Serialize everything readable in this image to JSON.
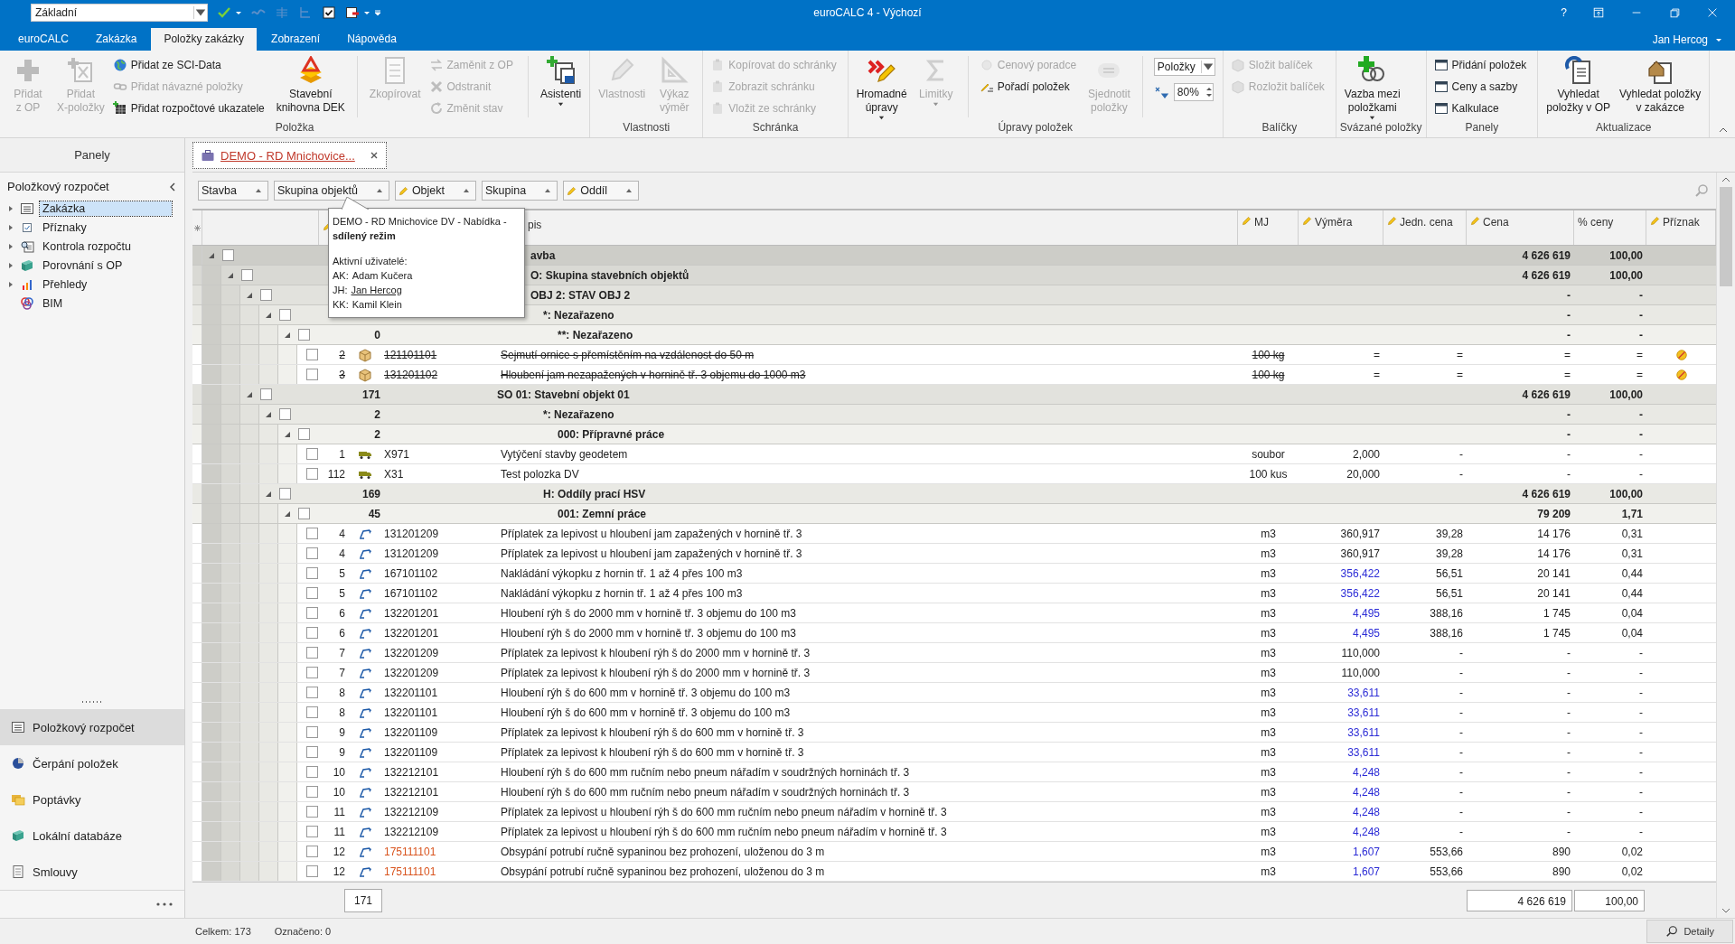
{
  "titlebar": {
    "layout_combo": "Základní",
    "title": "euroCALC 4 - Výchozí",
    "help": "?"
  },
  "tabs": [
    {
      "label": "euroCALC",
      "selected": false
    },
    {
      "label": "Zakázka",
      "selected": false
    },
    {
      "label": "Položky zakázky",
      "selected": true
    },
    {
      "label": "Zobrazení",
      "selected": false
    },
    {
      "label": "Nápověda",
      "selected": false
    }
  ],
  "user": "Jan Hercog",
  "ribbon": {
    "groups": [
      {
        "label": "Položka",
        "parts": [
          {
            "kind": "large",
            "lines": [
              "Přidat",
              "z OP"
            ],
            "disabled": true,
            "dropdown": false
          },
          {
            "kind": "large",
            "lines": [
              "Přidat",
              "X-položky"
            ],
            "disabled": true,
            "dropdown": false
          },
          {
            "kind": "stack",
            "items": [
              {
                "label": "Přidat ze SCI-Data",
                "disabled": false
              },
              {
                "label": "Přidat návazné položky",
                "disabled": true
              },
              {
                "label": "Přidat rozpočtové ukazatele",
                "disabled": false
              }
            ]
          },
          {
            "kind": "large",
            "lines": [
              "Stavební",
              "knihovna DEK"
            ],
            "disabled": false,
            "dropdown": false
          },
          {
            "kind": "separator"
          },
          {
            "kind": "large",
            "lines": [
              "Zkopírovat"
            ],
            "disabled": true,
            "dropdown": false
          },
          {
            "kind": "stack",
            "items": [
              {
                "label": "Zaměnit z OP",
                "disabled": true
              },
              {
                "label": "Odstranit",
                "disabled": true
              },
              {
                "label": "Změnit stav",
                "disabled": true
              }
            ]
          },
          {
            "kind": "separator"
          },
          {
            "kind": "large",
            "lines": [
              "Asistenti"
            ],
            "disabled": false,
            "dropdown": true
          }
        ]
      },
      {
        "label": "Vlastnosti",
        "parts": [
          {
            "kind": "large",
            "lines": [
              "Vlastnosti"
            ],
            "disabled": true,
            "dropdown": false
          },
          {
            "kind": "large",
            "lines": [
              "Výkaz",
              "výměr"
            ],
            "disabled": true,
            "dropdown": false
          }
        ]
      },
      {
        "label": "Schránka",
        "parts": [
          {
            "kind": "stack",
            "items": [
              {
                "label": "Kopírovat do schránky",
                "disabled": true
              },
              {
                "label": "Zobrazit schránku",
                "disabled": true
              },
              {
                "label": "Vložit ze schránky",
                "disabled": true
              }
            ]
          }
        ]
      },
      {
        "label": "Úpravy položek",
        "parts": [
          {
            "kind": "large",
            "lines": [
              "Hromadné",
              "úpravy"
            ],
            "disabled": false,
            "dropdown": true
          },
          {
            "kind": "large",
            "lines": [
              "Limitky"
            ],
            "disabled": true,
            "dropdown": true
          },
          {
            "kind": "separator"
          },
          {
            "kind": "stack",
            "items": [
              {
                "label": "Cenový poradce",
                "disabled": true
              },
              {
                "label": "Pořadí položek",
                "disabled": false
              }
            ]
          },
          {
            "kind": "large",
            "lines": [
              "Sjednotit",
              "položky"
            ],
            "disabled": true,
            "dropdown": false
          },
          {
            "kind": "separator"
          },
          {
            "kind": "zoom",
            "combo": "Položky",
            "percent": "80%"
          }
        ]
      },
      {
        "label": "Balíčky",
        "parts": [
          {
            "kind": "stack",
            "items": [
              {
                "label": "Složit balíček",
                "disabled": true
              },
              {
                "label": "Rozložit balíček",
                "disabled": true
              }
            ]
          }
        ]
      },
      {
        "label": "Svázané položky",
        "parts": [
          {
            "kind": "large",
            "lines": [
              "Vazba mezi",
              "položkami"
            ],
            "disabled": false,
            "dropdown": true
          }
        ]
      },
      {
        "label": "Panely",
        "parts": [
          {
            "kind": "stack",
            "items": [
              {
                "label": "Přidání položek",
                "disabled": false
              },
              {
                "label": "Ceny a sazby",
                "disabled": false
              },
              {
                "label": "Kalkulace",
                "disabled": false
              }
            ]
          }
        ]
      },
      {
        "label": "Aktualizace",
        "parts": [
          {
            "kind": "large",
            "lines": [
              "Vyhledat",
              "položky v OP"
            ],
            "disabled": false,
            "dropdown": false
          },
          {
            "kind": "large",
            "lines": [
              "Vyhledat položky",
              "v zakázce"
            ],
            "disabled": false,
            "dropdown": false
          }
        ]
      }
    ]
  },
  "sidebar": {
    "header": "Panely",
    "section": "Položkový rozpočet",
    "tree": [
      {
        "label": "Zakázka",
        "selected": true,
        "has_children": true
      },
      {
        "label": "Příznaky",
        "selected": false,
        "has_children": true
      },
      {
        "label": "Kontrola rozpočtu",
        "selected": false,
        "has_children": true
      },
      {
        "label": "Porovnání s OP",
        "selected": false,
        "has_children": true
      },
      {
        "label": "Přehledy",
        "selected": false,
        "has_children": true
      },
      {
        "label": "BIM",
        "selected": false,
        "has_children": false
      }
    ],
    "nav": [
      {
        "label": "Položkový rozpočet",
        "selected": true
      },
      {
        "label": "Čerpání položek",
        "selected": false
      },
      {
        "label": "Poptávky",
        "selected": false
      },
      {
        "label": "Lokální databáze",
        "selected": false
      },
      {
        "label": "Smlouvy",
        "selected": false
      }
    ]
  },
  "document_tab": {
    "label": "DEMO - RD Mnichovice..."
  },
  "grid": {
    "group_chips": [
      {
        "label": "Stavba",
        "editable": false
      },
      {
        "label": "Skupina objektů",
        "editable": false
      },
      {
        "label": "Objekt",
        "editable": true
      },
      {
        "label": "Skupina",
        "editable": false
      },
      {
        "label": "Oddíl",
        "editable": true
      }
    ],
    "columns": [
      {
        "editable": true
      },
      {
        "label": "pis",
        "editable": false
      },
      {
        "label": "MJ",
        "editable": true
      },
      {
        "label": "Výměra",
        "editable": true
      },
      {
        "label": "Jedn. cena",
        "editable": true
      },
      {
        "label": "Cena",
        "editable": true
      },
      {
        "label": "% ceny",
        "editable": false
      },
      {
        "label": "Příznak",
        "editable": true
      }
    ],
    "tree": [
      {
        "kind": "group",
        "title": "avba",
        "cena": "4 626 619",
        "pct": "100,00",
        "expanded": true,
        "checked": false,
        "children": [
          {
            "kind": "group",
            "title": "O: Skupina stavebních objektů",
            "cena": "4 626 619",
            "pct": "100,00",
            "expanded": true,
            "checked": false,
            "children": [
              {
                "kind": "group",
                "title": "OBJ 2: STAV OBJ 2",
                "cena": "-",
                "pct": "-",
                "expanded": true,
                "checked": false,
                "children": [
                  {
                    "kind": "group",
                    "title": "*: Nezařazeno",
                    "cena": "-",
                    "pct": "-",
                    "expanded": true,
                    "checked": false,
                    "children": [
                      {
                        "kind": "group",
                        "count": "0",
                        "title": "**: Nezařazeno",
                        "cena": "-",
                        "pct": "-",
                        "expanded": true,
                        "checked": false,
                        "children": [
                          {
                            "kind": "material",
                            "number": "2",
                            "code": "121101101",
                            "popis": "Sejmutí ornice s přemístěním na vzdálenost do 50 m",
                            "mj": "100 kg",
                            "vymera": "=",
                            "jedn": "=",
                            "cena": "=",
                            "pct": "=",
                            "checked": false,
                            "struck": true,
                            "code_alert": false,
                            "vymera_linked": false,
                            "flag": true
                          },
                          {
                            "kind": "material",
                            "number": "3",
                            "code": "131201102",
                            "popis": "Hloubení jam nezapažených v hornině tř. 3 objemu do 1000 m3",
                            "mj": "100 kg",
                            "vymera": "=",
                            "jedn": "=",
                            "cena": "=",
                            "pct": "=",
                            "checked": false,
                            "struck": true,
                            "code_alert": false,
                            "vymera_linked": false,
                            "flag": true
                          }
                        ]
                      }
                    ]
                  }
                ]
              },
              {
                "kind": "group",
                "count": "171",
                "title": "SO 01: Stavební objekt 01",
                "cena": "4 626 619",
                "pct": "100,00",
                "expanded": true,
                "checked": false,
                "children": [
                  {
                    "kind": "group",
                    "count": "2",
                    "title": "*: Nezařazeno",
                    "cena": "-",
                    "pct": "-",
                    "expanded": true,
                    "checked": false,
                    "children": [
                      {
                        "kind": "group",
                        "count": "2",
                        "title": "000: Přípravné práce",
                        "cena": "-",
                        "pct": "-",
                        "expanded": true,
                        "checked": false,
                        "children": [
                          {
                            "kind": "transport",
                            "number": "1",
                            "code": "X971",
                            "popis": "Vytýčení stavby geodetem",
                            "mj": "soubor",
                            "vymera": "2,000",
                            "jedn": "-",
                            "cena": "-",
                            "pct": "-",
                            "checked": false,
                            "struck": false,
                            "code_alert": false,
                            "vymera_linked": false,
                            "flag": false
                          },
                          {
                            "kind": "transport",
                            "number": "112",
                            "code": "X31",
                            "popis": "Test polozka DV",
                            "mj": "100 kus",
                            "vymera": "20,000",
                            "jedn": "-",
                            "cena": "-",
                            "pct": "-",
                            "checked": false,
                            "struck": false,
                            "code_alert": false,
                            "vymera_linked": false,
                            "flag": false
                          }
                        ]
                      }
                    ]
                  },
                  {
                    "kind": "group",
                    "count": "169",
                    "title": "H: Oddíly prací HSV",
                    "cena": "4 626 619",
                    "pct": "100,00",
                    "expanded": true,
                    "checked": false,
                    "children": [
                      {
                        "kind": "group",
                        "count": "45",
                        "title": "001: Zemní práce",
                        "cena": "79 209",
                        "pct": "1,71",
                        "expanded": true,
                        "checked": false,
                        "children": [
                          {
                            "kind": "earthwork",
                            "number": "4",
                            "code": "131201209",
                            "popis": "Příplatek za lepivost u hloubení jam zapažených v hornině tř. 3",
                            "mj": "m3",
                            "vymera": "360,917",
                            "jedn": "39,28",
                            "cena": "14 176",
                            "pct": "0,31",
                            "checked": false,
                            "struck": false,
                            "code_alert": false,
                            "vymera_linked": false,
                            "flag": false
                          },
                          {
                            "kind": "earthwork",
                            "number": "4",
                            "code": "131201209",
                            "popis": "Příplatek za lepivost u hloubení jam zapažených v hornině tř. 3",
                            "mj": "m3",
                            "vymera": "360,917",
                            "jedn": "39,28",
                            "cena": "14 176",
                            "pct": "0,31",
                            "checked": false,
                            "struck": false,
                            "code_alert": false,
                            "vymera_linked": false,
                            "flag": false
                          },
                          {
                            "kind": "earthwork",
                            "number": "5",
                            "code": "167101102",
                            "popis": "Nakládání výkopku z hornin tř. 1 až 4 přes 100 m3",
                            "mj": "m3",
                            "vymera": "356,422",
                            "jedn": "56,51",
                            "cena": "20 141",
                            "pct": "0,44",
                            "checked": false,
                            "struck": false,
                            "code_alert": false,
                            "vymera_linked": true,
                            "flag": false
                          },
                          {
                            "kind": "earthwork",
                            "number": "5",
                            "code": "167101102",
                            "popis": "Nakládání výkopku z hornin tř. 1 až 4 přes 100 m3",
                            "mj": "m3",
                            "vymera": "356,422",
                            "jedn": "56,51",
                            "cena": "20 141",
                            "pct": "0,44",
                            "checked": false,
                            "struck": false,
                            "code_alert": false,
                            "vymera_linked": true,
                            "flag": false
                          },
                          {
                            "kind": "earthwork",
                            "number": "6",
                            "code": "132201201",
                            "popis": "Hloubení rýh š do 2000 mm v hornině tř. 3 objemu do 100 m3",
                            "mj": "m3",
                            "vymera": "4,495",
                            "jedn": "388,16",
                            "cena": "1 745",
                            "pct": "0,04",
                            "checked": false,
                            "struck": false,
                            "code_alert": false,
                            "vymera_linked": true,
                            "flag": false
                          },
                          {
                            "kind": "earthwork",
                            "number": "6",
                            "code": "132201201",
                            "popis": "Hloubení rýh š do 2000 mm v hornině tř. 3 objemu do 100 m3",
                            "mj": "m3",
                            "vymera": "4,495",
                            "jedn": "388,16",
                            "cena": "1 745",
                            "pct": "0,04",
                            "checked": false,
                            "struck": false,
                            "code_alert": false,
                            "vymera_linked": true,
                            "flag": false
                          },
                          {
                            "kind": "earthwork",
                            "number": "7",
                            "code": "132201209",
                            "popis": "Příplatek za lepivost k hloubení rýh š do 2000 mm v hornině tř. 3",
                            "mj": "m3",
                            "vymera": "110,000",
                            "jedn": "-",
                            "cena": "-",
                            "pct": "-",
                            "checked": false,
                            "struck": false,
                            "code_alert": false,
                            "vymera_linked": false,
                            "flag": false
                          },
                          {
                            "kind": "earthwork",
                            "number": "7",
                            "code": "132201209",
                            "popis": "Příplatek za lepivost k hloubení rýh š do 2000 mm v hornině tř. 3",
                            "mj": "m3",
                            "vymera": "110,000",
                            "jedn": "-",
                            "cena": "-",
                            "pct": "-",
                            "checked": false,
                            "struck": false,
                            "code_alert": false,
                            "vymera_linked": false,
                            "flag": false
                          },
                          {
                            "kind": "earthwork",
                            "number": "8",
                            "code": "132201101",
                            "popis": "Hloubení rýh š do 600 mm v hornině tř. 3 objemu do 100 m3",
                            "mj": "m3",
                            "vymera": "33,611",
                            "jedn": "-",
                            "cena": "-",
                            "pct": "-",
                            "checked": false,
                            "struck": false,
                            "code_alert": false,
                            "vymera_linked": true,
                            "flag": false
                          },
                          {
                            "kind": "earthwork",
                            "number": "8",
                            "code": "132201101",
                            "popis": "Hloubení rýh š do 600 mm v hornině tř. 3 objemu do 100 m3",
                            "mj": "m3",
                            "vymera": "33,611",
                            "jedn": "-",
                            "cena": "-",
                            "pct": "-",
                            "checked": false,
                            "struck": false,
                            "code_alert": false,
                            "vymera_linked": true,
                            "flag": false
                          },
                          {
                            "kind": "earthwork",
                            "number": "9",
                            "code": "132201109",
                            "popis": "Příplatek za lepivost k hloubení rýh š do 600 mm v hornině tř. 3",
                            "mj": "m3",
                            "vymera": "33,611",
                            "jedn": "-",
                            "cena": "-",
                            "pct": "-",
                            "checked": false,
                            "struck": false,
                            "code_alert": false,
                            "vymera_linked": true,
                            "flag": false
                          },
                          {
                            "kind": "earthwork",
                            "number": "9",
                            "code": "132201109",
                            "popis": "Příplatek za lepivost k hloubení rýh š do 600 mm v hornině tř. 3",
                            "mj": "m3",
                            "vymera": "33,611",
                            "jedn": "-",
                            "cena": "-",
                            "pct": "-",
                            "checked": false,
                            "struck": false,
                            "code_alert": false,
                            "vymera_linked": true,
                            "flag": false
                          },
                          {
                            "kind": "earthwork",
                            "number": "10",
                            "code": "132212101",
                            "popis": "Hloubení rýh š do 600 mm ručním nebo pneum nářadím v soudržných horninách tř. 3",
                            "mj": "m3",
                            "vymera": "4,248",
                            "jedn": "-",
                            "cena": "-",
                            "pct": "-",
                            "checked": false,
                            "struck": false,
                            "code_alert": false,
                            "vymera_linked": true,
                            "flag": false
                          },
                          {
                            "kind": "earthwork",
                            "number": "10",
                            "code": "132212101",
                            "popis": "Hloubení rýh š do 600 mm ručním nebo pneum nářadím v soudržných horninách tř. 3",
                            "mj": "m3",
                            "vymera": "4,248",
                            "jedn": "-",
                            "cena": "-",
                            "pct": "-",
                            "checked": false,
                            "struck": false,
                            "code_alert": false,
                            "vymera_linked": true,
                            "flag": false
                          },
                          {
                            "kind": "earthwork",
                            "number": "11",
                            "code": "132212109",
                            "popis": "Příplatek za lepivost u hloubení rýh š do 600 mm ručním nebo pneum nářadím v hornině tř. 3",
                            "mj": "m3",
                            "vymera": "4,248",
                            "jedn": "-",
                            "cena": "-",
                            "pct": "-",
                            "checked": false,
                            "struck": false,
                            "code_alert": false,
                            "vymera_linked": true,
                            "flag": false
                          },
                          {
                            "kind": "earthwork",
                            "number": "11",
                            "code": "132212109",
                            "popis": "Příplatek za lepivost u hloubení rýh š do 600 mm ručním nebo pneum nářadím v hornině tř. 3",
                            "mj": "m3",
                            "vymera": "4,248",
                            "jedn": "-",
                            "cena": "-",
                            "pct": "-",
                            "checked": false,
                            "struck": false,
                            "code_alert": false,
                            "vymera_linked": true,
                            "flag": false
                          },
                          {
                            "kind": "earthwork",
                            "number": "12",
                            "code": "175111101",
                            "popis": "Obsypání potrubí ručně sypaninou bez prohození, uloženou do 3 m",
                            "mj": "m3",
                            "vymera": "1,607",
                            "jedn": "553,66",
                            "cena": "890",
                            "pct": "0,02",
                            "checked": false,
                            "struck": false,
                            "code_alert": true,
                            "vymera_linked": true,
                            "flag": false
                          },
                          {
                            "kind": "earthwork",
                            "number": "12",
                            "code": "175111101",
                            "popis": "Obsypání potrubí ručně sypaninou bez prohození, uloženou do 3 m",
                            "mj": "m3",
                            "vymera": "1,607",
                            "jedn": "553,66",
                            "cena": "890",
                            "pct": "0,02",
                            "checked": false,
                            "struck": false,
                            "code_alert": true,
                            "vymera_linked": true,
                            "flag": false
                          }
                        ]
                      }
                    ]
                  }
                ]
              }
            ]
          }
        ]
      }
    ],
    "footer": {
      "count": "171",
      "cena": "4 626 619",
      "pct": "100,00"
    }
  },
  "tooltip": {
    "text": "DEMO - RD Mnichovice DV - Nabídka - **sdílený režim**",
    "users_title": "Aktivní uživatelé:",
    "users": [
      {
        "initials": "AK:",
        "name": "Adam Kučera",
        "link": false
      },
      {
        "initials": "JH:",
        "name": "Jan Hercog",
        "link": true
      },
      {
        "initials": "KK:",
        "name": "Kamil Klein",
        "link": false
      }
    ]
  },
  "status_bar": {
    "total": "Celkem: 173",
    "marked": "Označeno: 0",
    "details": "Detaily"
  }
}
